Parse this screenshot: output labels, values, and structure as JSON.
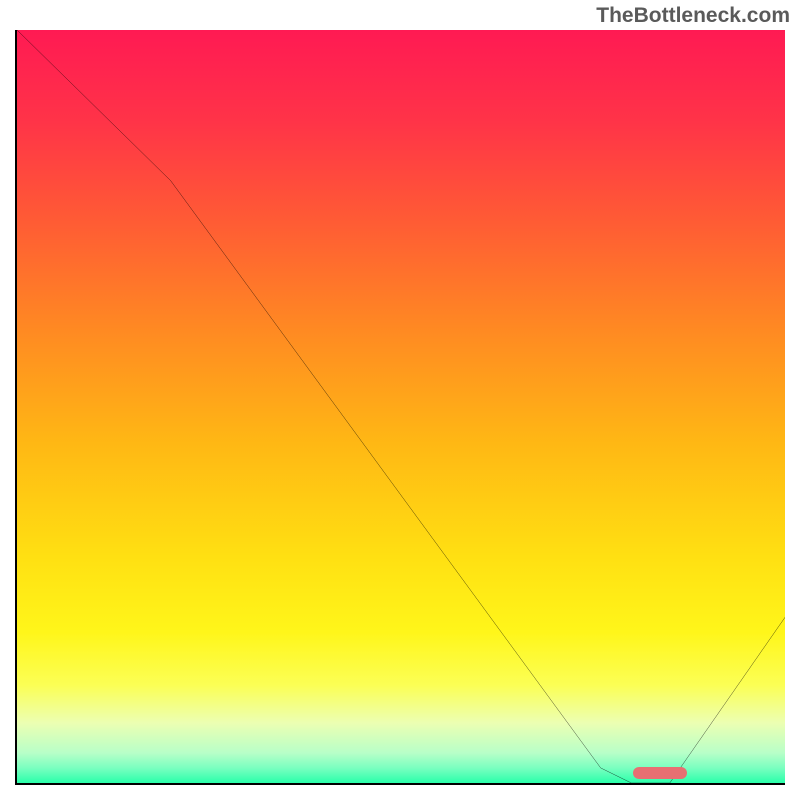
{
  "watermark": "TheBottleneck.com",
  "gradient_stops": [
    {
      "offset": "0%",
      "color": "#ff1a53"
    },
    {
      "offset": "12%",
      "color": "#ff3348"
    },
    {
      "offset": "25%",
      "color": "#ff5a35"
    },
    {
      "offset": "40%",
      "color": "#ff8a22"
    },
    {
      "offset": "55%",
      "color": "#ffb814"
    },
    {
      "offset": "70%",
      "color": "#ffe012"
    },
    {
      "offset": "80%",
      "color": "#fff61a"
    },
    {
      "offset": "87%",
      "color": "#fbff55"
    },
    {
      "offset": "92%",
      "color": "#ecffb2"
    },
    {
      "offset": "96%",
      "color": "#b8ffc8"
    },
    {
      "offset": "98%",
      "color": "#7affc0"
    },
    {
      "offset": "100%",
      "color": "#2affaa"
    }
  ],
  "chart_data": {
    "type": "line",
    "title": "",
    "xlabel": "",
    "ylabel": "",
    "xlim": [
      0,
      100
    ],
    "ylim": [
      0,
      100
    ],
    "x": [
      0,
      20,
      76,
      80,
      85,
      100
    ],
    "values": [
      100,
      80,
      2,
      0,
      0,
      22
    ],
    "optimal_range_x": [
      80,
      87
    ],
    "annotations": [
      "TheBottleneck.com"
    ]
  },
  "colors": {
    "curve": "#000000",
    "axis": "#000000",
    "marker": "#e76f72",
    "watermark": "#5a5a5a"
  }
}
